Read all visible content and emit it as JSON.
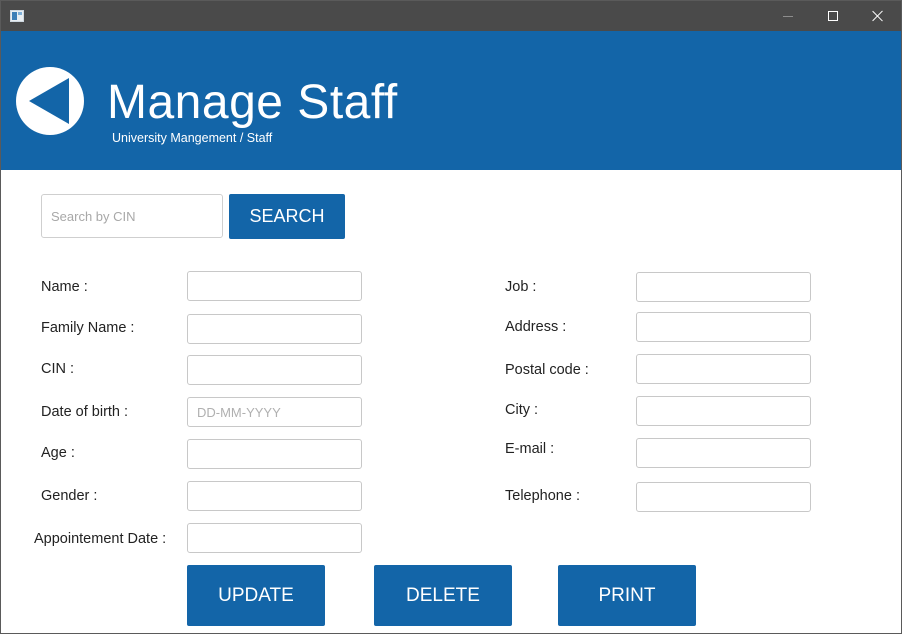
{
  "window": {
    "controls": {
      "minimize": "minimize-icon",
      "maximize": "maximize-icon",
      "close": "close-icon"
    }
  },
  "header": {
    "title": "Manage Staff",
    "breadcrumb": "University Mangement / Staff",
    "back_icon": "back-arrow-icon",
    "background_color": "#1365a8"
  },
  "search": {
    "placeholder": "Search by CIN",
    "value": "",
    "button_label": "SEARCH"
  },
  "form": {
    "left": [
      {
        "label": "Name :",
        "value": "",
        "placeholder": ""
      },
      {
        "label": "Family Name :",
        "value": "",
        "placeholder": ""
      },
      {
        "label": "CIN :",
        "value": "",
        "placeholder": ""
      },
      {
        "label": "Date of birth :",
        "value": "",
        "placeholder": "DD-MM-YYYY"
      },
      {
        "label": "Age :",
        "value": "",
        "placeholder": ""
      },
      {
        "label": "Gender :",
        "value": "",
        "placeholder": ""
      },
      {
        "label": "Appointement Date :",
        "value": "",
        "placeholder": ""
      }
    ],
    "right": [
      {
        "label": "Job :",
        "value": "",
        "placeholder": ""
      },
      {
        "label": "Address :",
        "value": "",
        "placeholder": ""
      },
      {
        "label": "Postal code :",
        "value": "",
        "placeholder": ""
      },
      {
        "label": "City :",
        "value": "",
        "placeholder": ""
      },
      {
        "label": "E-mail :",
        "value": "",
        "placeholder": ""
      },
      {
        "label": "Telephone :",
        "value": "",
        "placeholder": ""
      }
    ]
  },
  "actions": {
    "update": "UPDATE",
    "delete": "DELETE",
    "print": "PRINT"
  },
  "colors": {
    "accent": "#1365a8",
    "titlebar": "#4a4a4a"
  }
}
